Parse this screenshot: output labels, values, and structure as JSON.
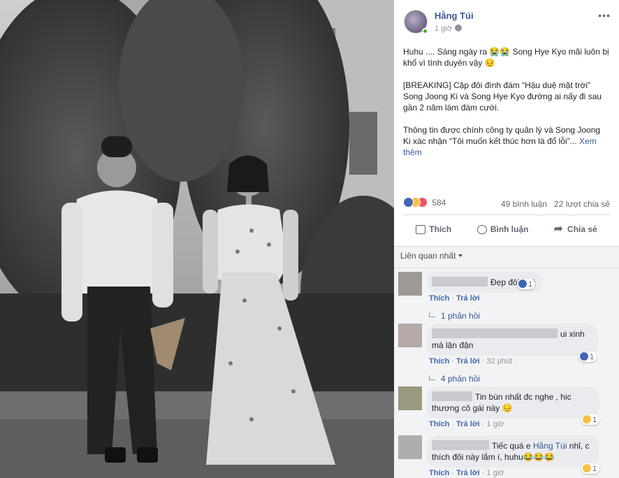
{
  "post": {
    "author": "Hằng Túi",
    "time": "1 giờ",
    "more_label": "•••",
    "paragraphs": [
      "Huhu .... Sáng ngày ra 😭😭 Song Hye Kyo mãi luôn bị khổ vì tình duyên vậy 😔",
      "[BREAKING] Cặp đôi đình đám “Hậu duệ mặt trời” Song Joong Ki và Song Hye Kyo đường ai nấy đi sau gần 2 năm làm đám cưới.",
      "Thông tin được chính công ty quản lý và Song Joong Ki xác nhận “Tôi muốn kết thúc hơn là đổ lỗi”..."
    ],
    "see_more": "Xem thêm",
    "reaction_count": "584",
    "comments_count": "49 bình luận",
    "shares_count": "22 lượt chia sẻ",
    "actions": {
      "like": "Thích",
      "comment": "Bình luận",
      "share": "Chia sẻ"
    }
  },
  "comments": {
    "sort_label": "Liên quan nhất",
    "like_label": "Thích",
    "reply_label": "Trả lời",
    "items": [
      {
        "text": "Đẹp đôi quá",
        "time": "",
        "reaction": "1",
        "reaction_type": "like",
        "replies": "1 phản hồi"
      },
      {
        "text_before": "ui xinh",
        "text": "mà lận đận",
        "time": "32 phút",
        "reaction": "1",
        "reaction_type": "like",
        "replies": "4 phản hồi"
      },
      {
        "text": "Tin bùn nhất đc nghe , hic",
        "text2": "thương cô gái này 😔",
        "time": "1 giờ",
        "reaction": "1",
        "reaction_type": "haha"
      },
      {
        "text_before": "Tiếc quá e",
        "mention": "Hằng Túi",
        "text": "nhỉ, c",
        "text2": "thích đôi này lắm í, huhu😂😂😂",
        "time": "1 giờ",
        "reaction": "1",
        "reaction_type": "haha"
      }
    ]
  },
  "colors": {
    "link": "#385898",
    "accent": "#4267b2",
    "muted": "#90949c",
    "comment_bg": "#f2f3f5",
    "bubble_bg": "#e9ebee"
  }
}
